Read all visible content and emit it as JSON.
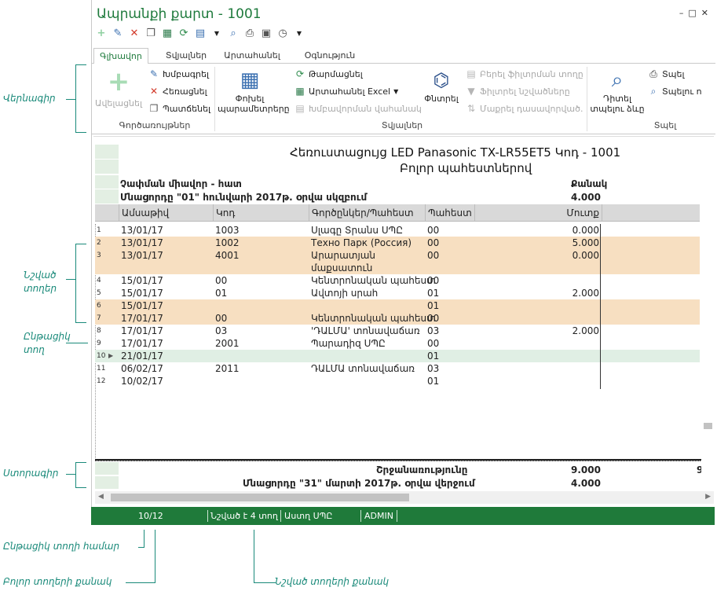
{
  "window": {
    "title": "Ապրանքի քարտ - 1001",
    "controls": [
      "–",
      "□",
      "✕"
    ]
  },
  "quick_access": [
    "plus-icon",
    "edit-icon",
    "delete-icon",
    "copy-icon",
    "export-icon",
    "refresh-icon",
    "grid-icon",
    "preview-icon",
    "print-icon",
    "print2-icon",
    "history-icon"
  ],
  "tabs": [
    {
      "label": "Գլխավոր",
      "active": true
    },
    {
      "label": "Տվյալներ",
      "active": false
    },
    {
      "label": "Արտահանել",
      "active": false
    },
    {
      "label": "Օգնություն",
      "active": false
    }
  ],
  "ribbon": {
    "add": "Ավելացնել",
    "edit": "Խմբագրել",
    "delete": "Հեռացնել",
    "copy": "Պատճենել",
    "group_operations": "Գործառույթներ",
    "change_params": "Փոխել պարամետրերը",
    "refresh": "Թարմացնել",
    "export_excel": "Արտահանել Excel",
    "edit_view": "Խմբավորման վահանակ",
    "find": "Փնտրել",
    "show_filter_row": "Բերել ֆիլտրման տողը",
    "filter_marked": "Ֆիլտրել նշվածները",
    "clear_sort": "Մաքրել դասավորված.",
    "group_data": "Տվյալներ",
    "view_form": "Դիտել տպելու ձևը",
    "print": "Տպել",
    "print_cell": "Տպելու ո",
    "group_print": "Տպել"
  },
  "report": {
    "title": "Հեռուստացույց LED Panasonic TX-LR55ET5 Կոդ - 1001",
    "subtitle": "Բոլոր պահեստներով",
    "unit": "Չափման միավոր - հատ",
    "qty_header": "Քանակ",
    "opening_label": "Մնացորդը \"01\" հունվարի 2017թ. օրվա սկզբում",
    "opening_value": "4.000",
    "columns": [
      "Ամսաթիվ",
      "Կոդ",
      "Գործընկեր/Պահեստ",
      "Պահեստ",
      "Մուտք"
    ],
    "rows": [
      {
        "n": "1",
        "date": "13/01/17",
        "code": "1003",
        "partner": "Սլագը Տրանս ՍՊԸ",
        "wh": "00",
        "in": "0.000",
        "state": "normal"
      },
      {
        "n": "2",
        "date": "13/01/17",
        "code": "1002",
        "partner": "Техно Парк (Россия)",
        "wh": "00",
        "in": "5.000",
        "state": "marked"
      },
      {
        "n": "3",
        "date": "13/01/17",
        "code": "4001",
        "partner": "Արարատյան",
        "partner2": "մաքսատուն",
        "wh": "00",
        "in": "0.000",
        "state": "marked"
      },
      {
        "n": "4",
        "date": "15/01/17",
        "code": "00",
        "partner": "Կենտրոնական պահեստ",
        "wh": "00",
        "in": "",
        "state": "normal"
      },
      {
        "n": "5",
        "date": "15/01/17",
        "code": "01",
        "partner": "Ավտոյի սրահ",
        "wh": "01",
        "in": "2.000",
        "state": "normal"
      },
      {
        "n": "6",
        "date": "15/01/17",
        "code": "",
        "partner": "",
        "wh": "01",
        "in": "",
        "state": "marked"
      },
      {
        "n": "7",
        "date": "17/01/17",
        "code": "00",
        "partner": "Կենտրոնական պահեստ",
        "wh": "00",
        "in": "",
        "state": "marked"
      },
      {
        "n": "8",
        "date": "17/01/17",
        "code": "03",
        "partner": "'ԴԱԼՄԱ' տոնավաճառ",
        "wh": "03",
        "in": "2.000",
        "state": "normal"
      },
      {
        "n": "9",
        "date": "17/01/17",
        "code": "2001",
        "partner": "Պարադիզ ՍՊԸ",
        "wh": "00",
        "in": "",
        "state": "normal"
      },
      {
        "n": "10",
        "date": "21/01/17",
        "code": "",
        "partner": "",
        "wh": "01",
        "in": "",
        "state": "current"
      },
      {
        "n": "11",
        "date": "06/02/17",
        "code": "2011",
        "partner": "ԴԱԼՄԱ տոնավաճառ",
        "wh": "03",
        "in": "",
        "state": "normal"
      },
      {
        "n": "12",
        "date": "10/02/17",
        "code": "",
        "partner": "",
        "wh": "01",
        "in": "",
        "state": "normal"
      }
    ],
    "turnover_label": "Շրջանառությունը",
    "turnover_value": "9.000",
    "turnover_extra": "9",
    "closing_label": "Մնացորդը \"31\" մարտի 2017թ. օրվա վերջում",
    "closing_value": "4.000"
  },
  "status": {
    "position": "10/12",
    "marked": "Նշված է 4 տող",
    "company": "Աստղ ՍՊԸ",
    "user": "ADMIN"
  },
  "annotations": {
    "header": "Վերնագիր",
    "marked_rows": "Նշված տողեր",
    "current_row": "Ընթացիկ տող",
    "footer": "Ստորագիր",
    "current_row_number": "Ընթացիկ տողի համար",
    "all_rows_count": "Բոլոր տողերի քանակ",
    "marked_rows_count": "Նշված տողերի քանակ"
  },
  "colors": {
    "accent": "#1e7a3c",
    "status_bg": "#1f7a3a",
    "marked_row": "#f7dfc1",
    "current_row": "#e0efe4",
    "annotation": "#1a8a7a"
  }
}
